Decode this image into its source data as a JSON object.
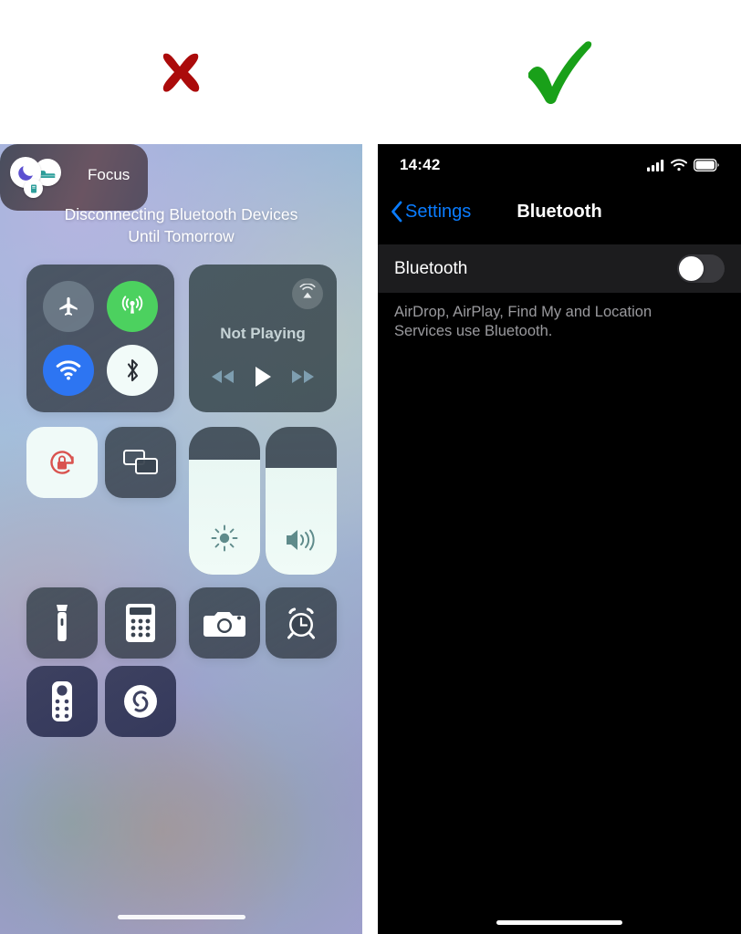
{
  "marks": {
    "left": {
      "icon": "cross-mark",
      "color": "#ab0b0b",
      "meaning": "incorrect"
    },
    "right": {
      "icon": "check-mark",
      "color": "#19a019",
      "meaning": "correct"
    }
  },
  "left_panel": {
    "name": "ios-control-center",
    "banner": "Disconnecting Bluetooth Devices\nUntil Tomorrow",
    "banner_line1": "Disconnecting Bluetooth Devices",
    "banner_line2": "Until Tomorrow",
    "connectivity": {
      "name": "connectivity-module",
      "toggles": [
        {
          "name": "airplane-mode",
          "label": "Airplane Mode",
          "state": "off",
          "color": "#76858f"
        },
        {
          "name": "cellular-data",
          "label": "Cellular Data",
          "state": "on",
          "color": "#4cd15f"
        },
        {
          "name": "wifi",
          "label": "Wi-Fi",
          "state": "on",
          "color": "#2d75f2"
        },
        {
          "name": "bluetooth",
          "label": "Bluetooth",
          "state": "disconnecting",
          "color": "#f2fbf9"
        }
      ]
    },
    "media": {
      "name": "now-playing-module",
      "title": "Not Playing",
      "airplay_label": "AirPlay",
      "controls": [
        {
          "name": "rewind",
          "label": "Rewind"
        },
        {
          "name": "play",
          "label": "Play"
        },
        {
          "name": "fast-forward",
          "label": "Fast Forward"
        }
      ]
    },
    "tiles": [
      {
        "name": "rotation-lock",
        "label": "Portrait Orientation Lock",
        "state": "on"
      },
      {
        "name": "screen-mirroring",
        "label": "Screen Mirroring",
        "state": "off"
      },
      {
        "name": "flashlight",
        "label": "Flashlight",
        "state": "off"
      },
      {
        "name": "calculator",
        "label": "Calculator",
        "state": "off"
      },
      {
        "name": "camera",
        "label": "Camera",
        "state": "off"
      },
      {
        "name": "alarm",
        "label": "Alarm",
        "state": "off"
      },
      {
        "name": "apple-tv-remote",
        "label": "Apple TV Remote",
        "state": "off"
      },
      {
        "name": "shazam",
        "label": "Shazam",
        "state": "off"
      }
    ],
    "focus": {
      "name": "focus-tile",
      "label": "Focus",
      "modes": [
        "Do Not Disturb",
        "Sleep",
        "Reading"
      ]
    },
    "sliders": [
      {
        "name": "brightness-slider",
        "label": "Brightness",
        "value": 78
      },
      {
        "name": "volume-slider",
        "label": "Volume",
        "value": 72
      }
    ]
  },
  "right_panel": {
    "name": "settings-bluetooth-screen",
    "status_bar": {
      "time": "14:42",
      "icons": [
        "cellular-signal",
        "wifi",
        "battery"
      ],
      "signal_bars": 4,
      "battery_level": 85
    },
    "nav": {
      "back_label": "Settings",
      "title": "Bluetooth"
    },
    "toggle_row": {
      "label": "Bluetooth",
      "state": "off"
    },
    "footnote": "AirDrop, AirPlay, Find My and Location Services use Bluetooth.",
    "accent_color": "#0a7cff"
  }
}
